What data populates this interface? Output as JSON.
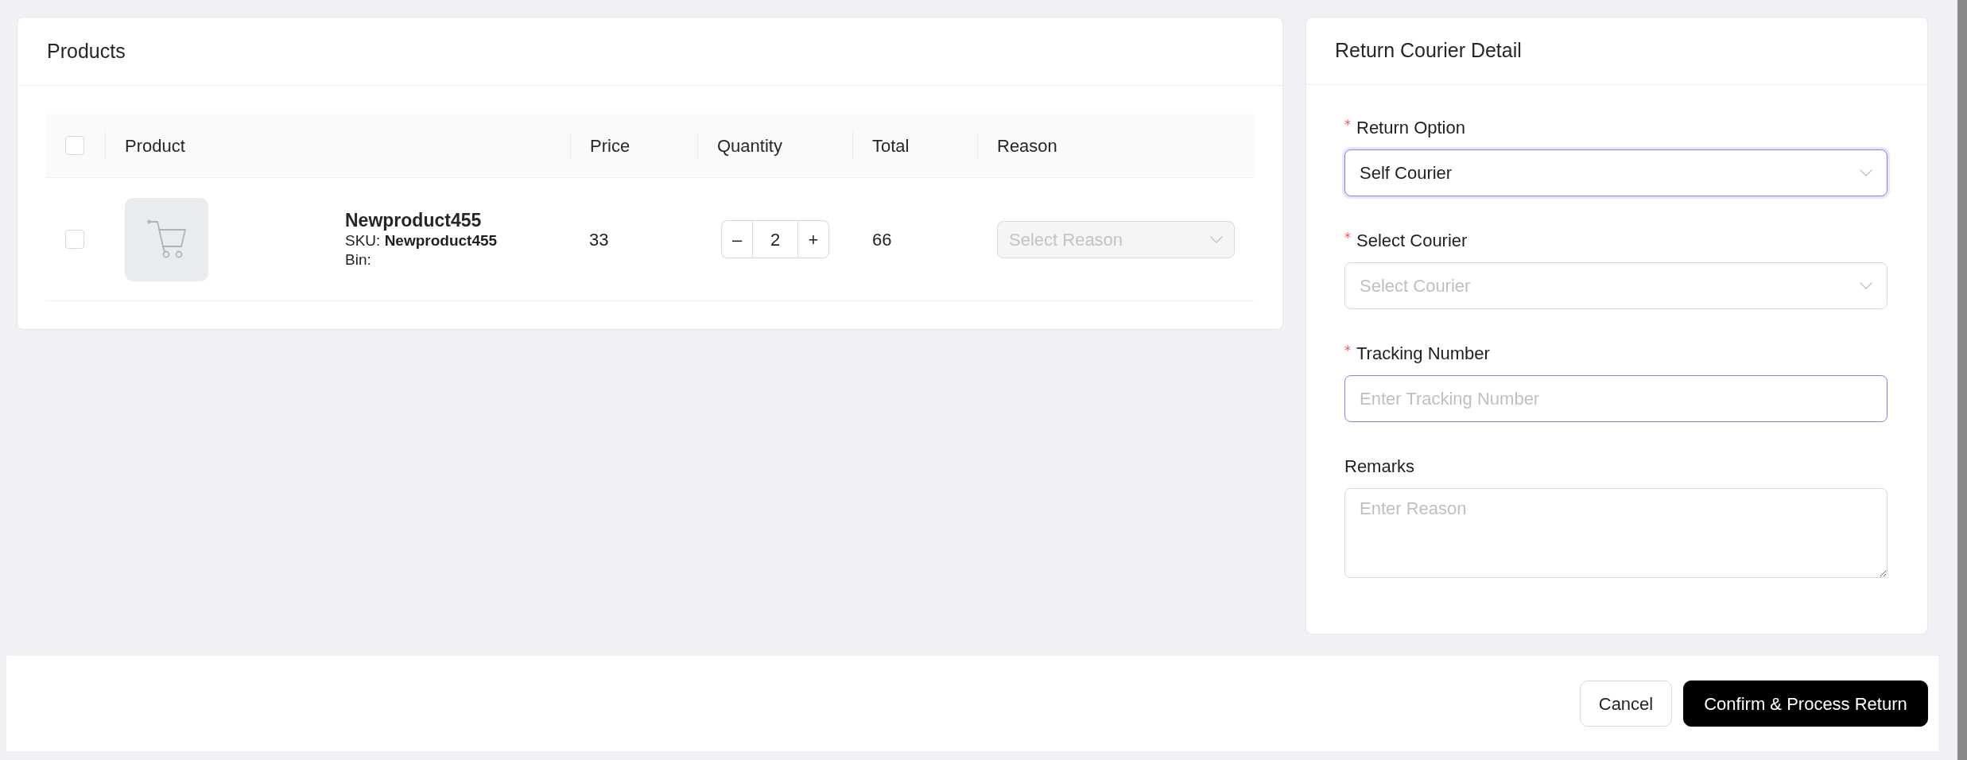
{
  "products": {
    "title": "Products",
    "select_all": {
      "checked": false
    },
    "columns": [
      "Product",
      "Price",
      "Quantity",
      "Total",
      "Reason"
    ],
    "rows": [
      {
        "checked": false,
        "name": "Newproduct455",
        "sku": "SKU: **Newproduct455**",
        "bin": "Bin:",
        "price": "33",
        "quantity": {
          "decrement": "–",
          "value": "2",
          "increment": "+"
        },
        "total": "66",
        "reason": {
          "placeholder": "Select Reason",
          "disabled": true
        }
      }
    ]
  },
  "return_courier": {
    "title": "Return Courier Detail",
    "fields": [
      {
        "kind": "select",
        "label": "Return Option",
        "required": true,
        "value": "Self Courier",
        "focused": true,
        "highlighted": true
      },
      {
        "kind": "select",
        "label": "Select Courier",
        "required": true,
        "placeholder": "Select Courier",
        "focused": false,
        "highlighted": false
      },
      {
        "kind": "input",
        "label": "Tracking Number",
        "required": true,
        "placeholder": "Enter Tracking Number",
        "focused": false,
        "highlighted": true
      },
      {
        "kind": "textarea",
        "label": "Remarks",
        "required": false,
        "placeholder": "Enter Reason",
        "focused": false,
        "highlighted": false
      }
    ]
  },
  "footer": {
    "buttons": [
      {
        "kind": "secondary",
        "label": "Cancel"
      },
      {
        "kind": "primary",
        "label": "Confirm & Process Return"
      }
    ]
  }
}
